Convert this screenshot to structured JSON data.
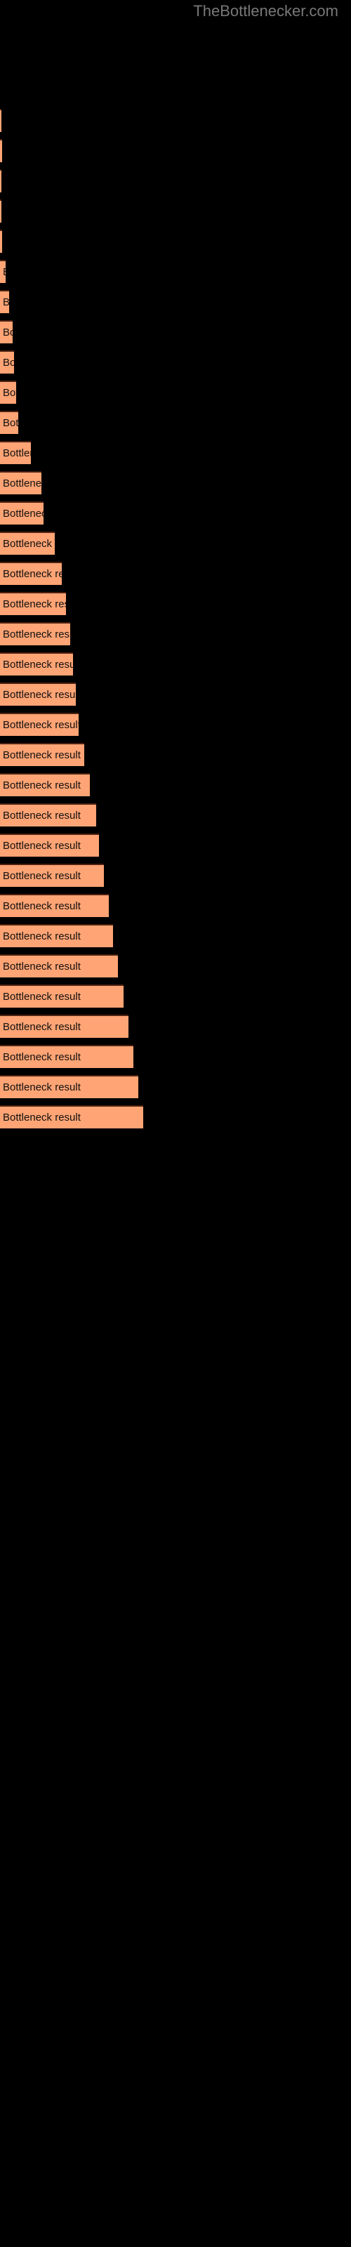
{
  "watermark": {
    "text": "TheBottlenecker.com",
    "color": "#787878"
  },
  "colors": {
    "background": "#000000",
    "bar_fill": "#ffa474",
    "bar_border_top": "#4d2212",
    "bar_label": "#101010"
  },
  "chart_data": {
    "type": "bar",
    "orientation": "horizontal",
    "title": "",
    "subtitle": "",
    "xlabel": "",
    "ylabel": "",
    "grid": false,
    "legend": null,
    "axis_visible": false,
    "tick_labels": [],
    "bar_label_text": "Bottleneck result",
    "xlim": [
      0,
      240
    ],
    "categories": [
      "",
      "",
      "",
      "",
      "",
      "",
      "",
      "",
      "",
      "",
      "",
      "",
      "",
      "",
      "",
      "",
      "",
      "",
      "",
      "",
      "",
      "",
      "",
      "",
      "",
      "",
      "",
      "",
      "",
      "",
      "",
      "",
      "",
      ""
    ],
    "values": [
      2,
      3,
      2,
      2,
      3,
      8,
      13,
      18,
      20,
      23,
      26,
      44,
      59,
      62,
      78,
      88,
      94,
      100,
      104,
      108,
      112,
      120,
      128,
      137,
      141,
      148,
      155,
      161,
      168,
      176,
      183,
      190,
      197,
      204
    ],
    "bar_tops": [
      322,
      365,
      408,
      451,
      494,
      537,
      580,
      623,
      666,
      709,
      752,
      795,
      838,
      881,
      924,
      967,
      1010,
      1053,
      1096,
      1139,
      1182,
      1225,
      1268,
      1311,
      1354,
      1397,
      1440,
      1483,
      1526,
      1569,
      1612,
      1655,
      1698,
      1741
    ]
  }
}
